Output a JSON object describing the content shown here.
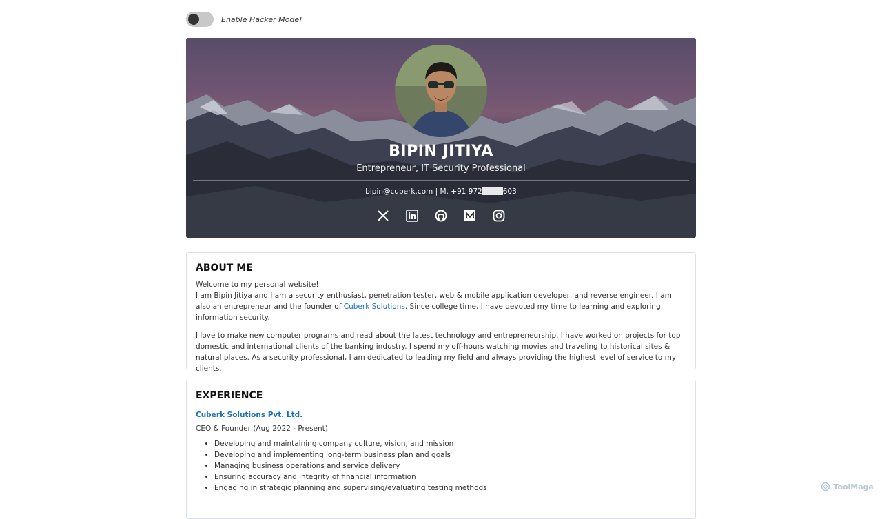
{
  "hacker_toggle": {
    "label": "Enable Hacker Mode!",
    "enabled": false
  },
  "profile": {
    "name": "BIPIN JITIYA",
    "tagline": "Entrepreneur, IT Security Professional",
    "email": "bipin@cuberk.com",
    "phone_prefix": " | M. +91 972",
    "phone_suffix": "603"
  },
  "socials": [
    {
      "name": "x-icon"
    },
    {
      "name": "linkedin-icon"
    },
    {
      "name": "github-icon"
    },
    {
      "name": "medium-icon"
    },
    {
      "name": "instagram-icon"
    }
  ],
  "about": {
    "heading": "ABOUT ME",
    "welcome": "Welcome to my personal website!",
    "intro_before": "I am Bipin Jitiya and I am a security enthusiast, penetration tester, web & mobile application developer, and reverse engineer. I am also an entrepreneur and the founder of ",
    "intro_link": "Cuberk Solutions",
    "intro_after": ". Since college time, I have devoted my time to learning and exploring information security.",
    "paragraph2": "I love to make new computer programs and read about the latest technology and entrepreneurship. I have worked on projects for top domestic and international clients of the banking industry. I spend my off-hours watching movies and traveling to historical sites & natural places. As a security professional, I am dedicated to leading my field and always providing the highest level of service to my clients."
  },
  "experience": {
    "heading": "EXPERIENCE",
    "company": "Cuberk Solutions Pvt. Ltd.",
    "role": "CEO & Founder (Aug 2022 - Present)",
    "bullets": [
      "Developing and maintaining company culture, vision, and mission",
      "Developing and implementing long-term business plan and goals",
      "Managing business operations and service delivery",
      "Ensuring accuracy and integrity of financial information",
      "Engaging in strategic planning and supervising/evaluating testing methods"
    ]
  },
  "watermark": {
    "text": "ToolMage"
  },
  "colors": {
    "link": "#1a6fbf",
    "hero_top": "#584d6a",
    "hero_bottom": "#262a36",
    "toggle_track": "#c8c8c8"
  }
}
